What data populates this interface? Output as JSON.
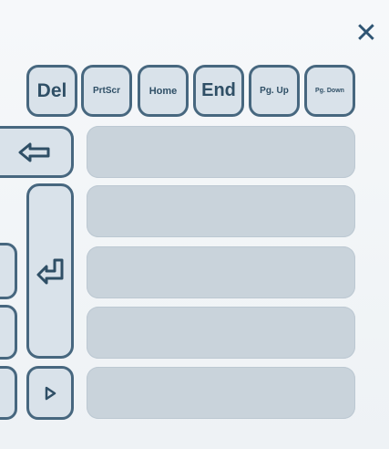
{
  "dialog": {
    "close_label": "✕"
  },
  "keys": {
    "del": "Del",
    "prtscr": "PrtScr",
    "home": "Home",
    "end": "End",
    "pgup": "Pg. Up",
    "pgdn": "Pg. Down"
  },
  "icons": {
    "close": "close-icon",
    "backspace": "backspace-arrow-icon",
    "enter": "enter-return-icon",
    "right": "right-triangle-icon"
  },
  "colors": {
    "key_border": "#47677f",
    "key_fill": "#d9e2ea",
    "key_text": "#2f4f66",
    "slot_fill": "#c9d3db",
    "background": "#f3f6f8"
  }
}
